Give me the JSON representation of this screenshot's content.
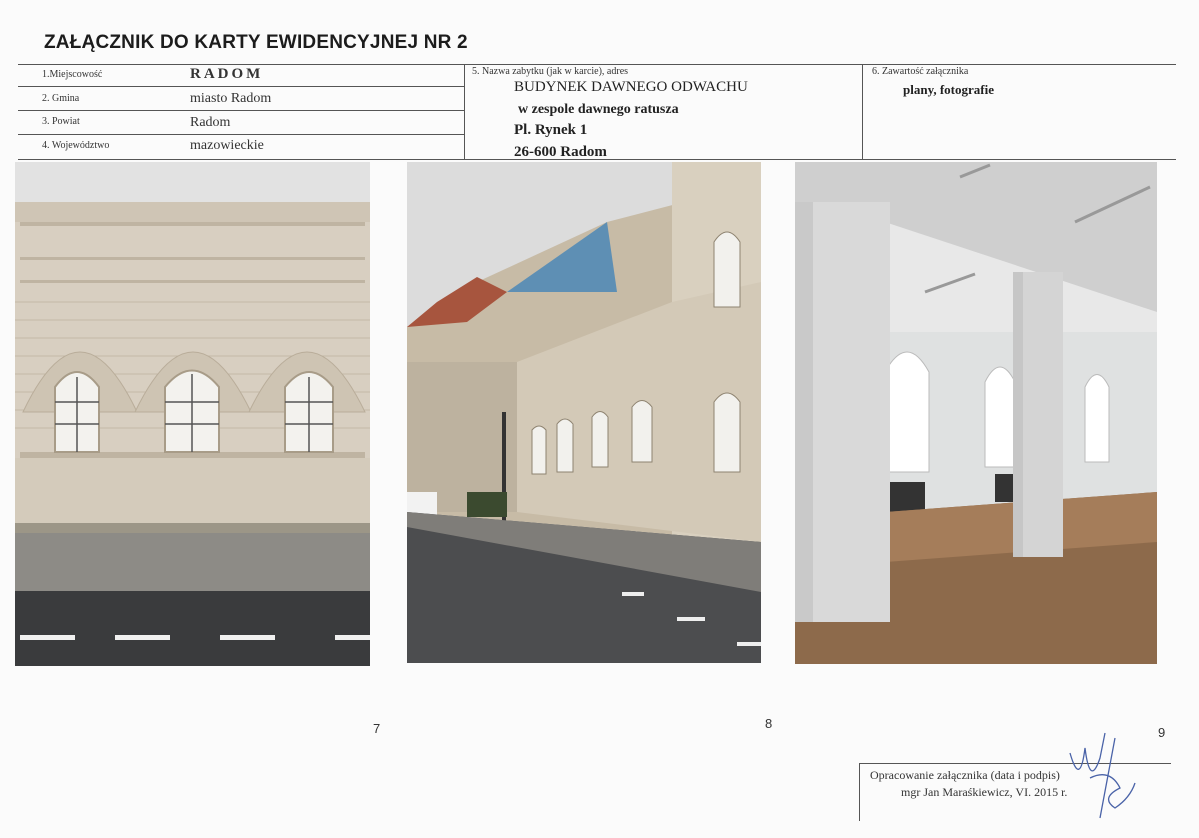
{
  "title": "ZAŁĄCZNIK DO KARTY EWIDENCYJNEJ NR 2",
  "fields": {
    "miejscowosc": {
      "label": "1.Miejscowość",
      "value": "RADOM"
    },
    "gmina": {
      "label": "2. Gmina",
      "value": "miasto Radom"
    },
    "powiat": {
      "label": "3. Powiat",
      "value": "Radom"
    },
    "wojewodztwo": {
      "label": "4. Województwo",
      "value": "mazowieckie"
    }
  },
  "monument": {
    "label": "5. Nazwa zabytku (jak w karcie), adres",
    "lines": [
      "BUDYNEK DAWNEGO ODWACHU",
      "w zespole dawnego ratusza",
      "Pl. Rynek 1",
      "26-600 Radom"
    ]
  },
  "contents": {
    "label": "6. Zawartość załącznika",
    "value": "plany, fotografie"
  },
  "photos": [
    {
      "number": "7",
      "subject": "building facade with arched windows"
    },
    {
      "number": "8",
      "subject": "street view of building"
    },
    {
      "number": "9",
      "subject": "interior hall with columns"
    }
  ],
  "signature": {
    "label": "Opracowanie załącznika (data i podpis)",
    "author": "mgr Jan Maraśkiewicz,  VI. 2015 r."
  },
  "colors": {
    "wall": "#d8cfc1",
    "sky": "#e2e2e2",
    "roof_blue": "#5e8fb4",
    "floor": "#9b7452"
  }
}
